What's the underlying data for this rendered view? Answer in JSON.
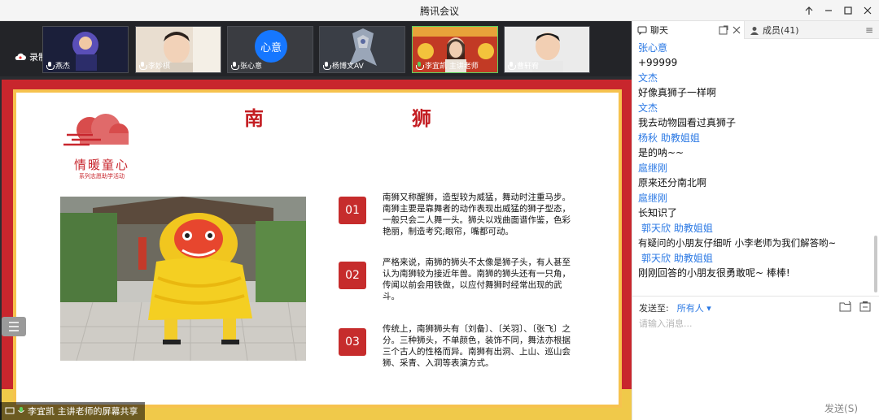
{
  "window": {
    "title": "腾讯会议"
  },
  "recording": {
    "label": "录制中"
  },
  "participants_bar": [
    {
      "name": "燕杰"
    },
    {
      "name": "李妙棋"
    },
    {
      "name": "张心意",
      "avatar_text": "心意"
    },
    {
      "name": "杨博文AV"
    },
    {
      "name": "李宜凯 主讲老师"
    },
    {
      "name": "曹轩宥"
    }
  ],
  "slide": {
    "title_left": "南",
    "title_right": "狮",
    "logo_main": "情暖童心",
    "logo_sub": "系列志愿助学活动",
    "items": [
      {
        "num": "01",
        "text": "南狮又称醒狮，造型较为威猛，舞动时注重马步。南狮主要是靠舞者的动作表现出威猛的狮子型态，一般只会二人舞一头。狮头以戏曲面谱作鉴，色彩艳丽，制造考究;眼帘，嘴都可动。"
      },
      {
        "num": "02",
        "text": "严格来说，南狮的狮头不太像是狮子头，有人甚至认为南狮较为接近年兽。南狮的狮头还有一只角，传闻以前会用铁做，以应付舞狮时经常出现的武斗。"
      },
      {
        "num": "03",
        "text": "传统上，南狮狮头有〔刘备〕、〔关羽〕、〔张飞〕之分。三种狮头，不单颜色，装饰不同，舞法亦根据三个古人的性格而异。南狮有出洞、上山、巡山会狮、采青、入洞等表演方式。"
      }
    ]
  },
  "share_label": "李宜凯 主讲老师的屏幕共享",
  "panel": {
    "chat_tab": "聊天",
    "members_tab": "成员(41)",
    "messages": [
      {
        "name": "张心意",
        "text": "+99999"
      },
      {
        "name": "文杰",
        "text": "好像真狮子一样啊"
      },
      {
        "name": "文杰",
        "text": "我去动物园看过真狮子"
      },
      {
        "name": "杨秋  助教姐姐",
        "text": "是的呐~~"
      },
      {
        "name": "扈继刚",
        "text": "原来还分南北啊"
      },
      {
        "name": "扈继刚",
        "text": "长知识了"
      },
      {
        "name": "郭天欣  助教姐姐",
        "text": "有疑问的小朋友仔细听  小李老师为我们解答哟~"
      },
      {
        "name": "郭天欣  助教姐姐",
        "text": "刚刚回答的小朋友很勇敢呢~  棒棒!"
      }
    ],
    "send_to_label": "发送至:",
    "send_to_value": "所有人",
    "input_placeholder": "请输入消息...",
    "send_button": "发送(S)"
  },
  "colors": {
    "accent": "#2a78e4",
    "slide_red": "#c8262d",
    "slide_gold": "#f6c24e"
  }
}
